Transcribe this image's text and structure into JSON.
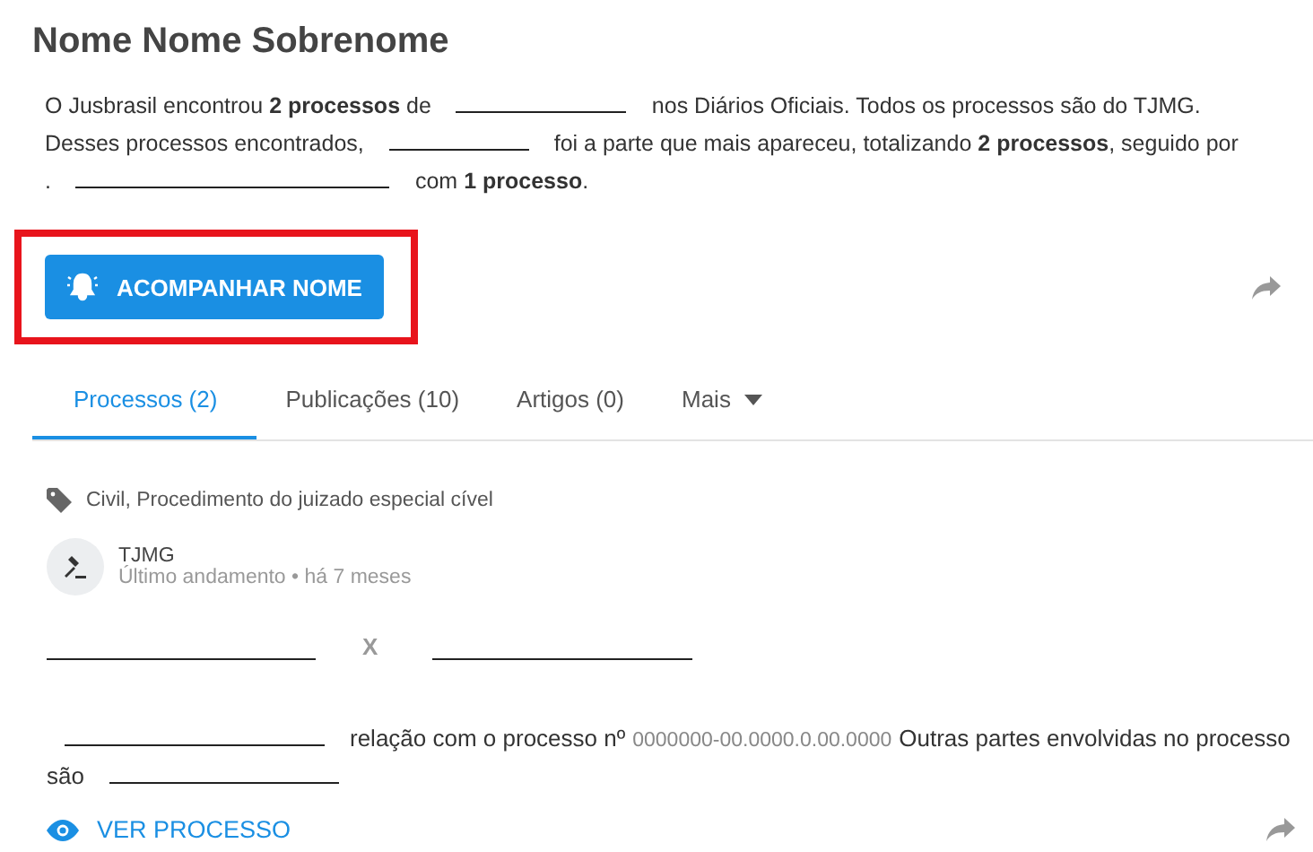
{
  "title": "Nome Nome Sobrenome",
  "summary": [
    {
      "kind": "text",
      "text": "O Jusbrasil encontrou **2 processos** de"
    },
    {
      "kind": "blank"
    },
    {
      "kind": "text",
      "text": "nos Diários Oficiais. Todos os processos são do TJMG. Desses processos encontrados,"
    },
    {
      "kind": "blank"
    },
    {
      "kind": "text",
      "text": "foi a parte que mais apareceu, totalizando **2 processos**, seguido por ."
    },
    {
      "kind": "blank"
    },
    {
      "kind": "text",
      "text": "com **1 processo**."
    }
  ],
  "follow_button": {
    "label": "ACOMPANHAR NOME",
    "highlighted": true
  },
  "tabs": [
    {
      "label": "Processos (2)",
      "selected": true
    },
    {
      "label": "Publicações (10)",
      "selected": false
    },
    {
      "label": "Artigos (0)",
      "selected": false
    },
    {
      "label": "Mais",
      "selected": false,
      "dropdown": true
    }
  ],
  "process": {
    "tags": "Civil, Procedimento do juizado especial cível",
    "court": "TJMG",
    "last_update": "Último andamento • há 7 meses",
    "versus": "X",
    "description": [
      {
        "kind": "blank"
      },
      {
        "kind": "text",
        "text": "relação com o processo nº"
      },
      {
        "kind": "number",
        "text": "0000000-00.0000.0.00.0000"
      },
      {
        "kind": "text",
        "text": "Outras partes envolvidas no processo são"
      },
      {
        "kind": "blank"
      }
    ],
    "view_link": "VER PROCESSO"
  }
}
